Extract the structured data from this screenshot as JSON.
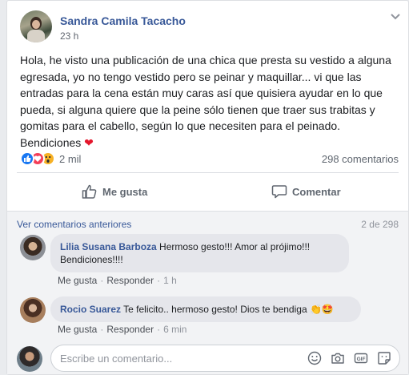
{
  "post": {
    "author": "Sandra Camila Tacacho",
    "time": "23 h",
    "text": "Hola, he visto una publicación de una chica que presta su vestido a alguna egresada, yo no tengo vestido pero se peinar y maquillar... vi que las entradas para la cena están muy caras así que quisiera ayudar en lo que pueda, si alguna quiere que la peine sólo tienen que traer sus trabitas y gomitas para el cabello, según lo que necesiten para el peinado. Bendiciones",
    "reaction_count": "2 mil",
    "comments_count": "298 comentarios"
  },
  "actions": {
    "like_label": "Me gusta",
    "comment_label": "Comentar"
  },
  "comments_section": {
    "prev_link": "Ver comentarios anteriores",
    "pager": "2 de 298",
    "items": [
      {
        "name": "Lilia Susana Barboza",
        "text": "Hermoso gesto!!! Amor al prójimo!!! Bendiciones!!!!",
        "like": "Me gusta",
        "reply": "Responder",
        "ago": "1 h"
      },
      {
        "name": "Rocio Suarez",
        "text": "Te felicito.. hermoso gesto! Dios te bendiga",
        "like": "Me gusta",
        "reply": "Responder",
        "ago": "6 min"
      }
    ]
  },
  "composer": {
    "placeholder": "Escribe un comentario..."
  }
}
